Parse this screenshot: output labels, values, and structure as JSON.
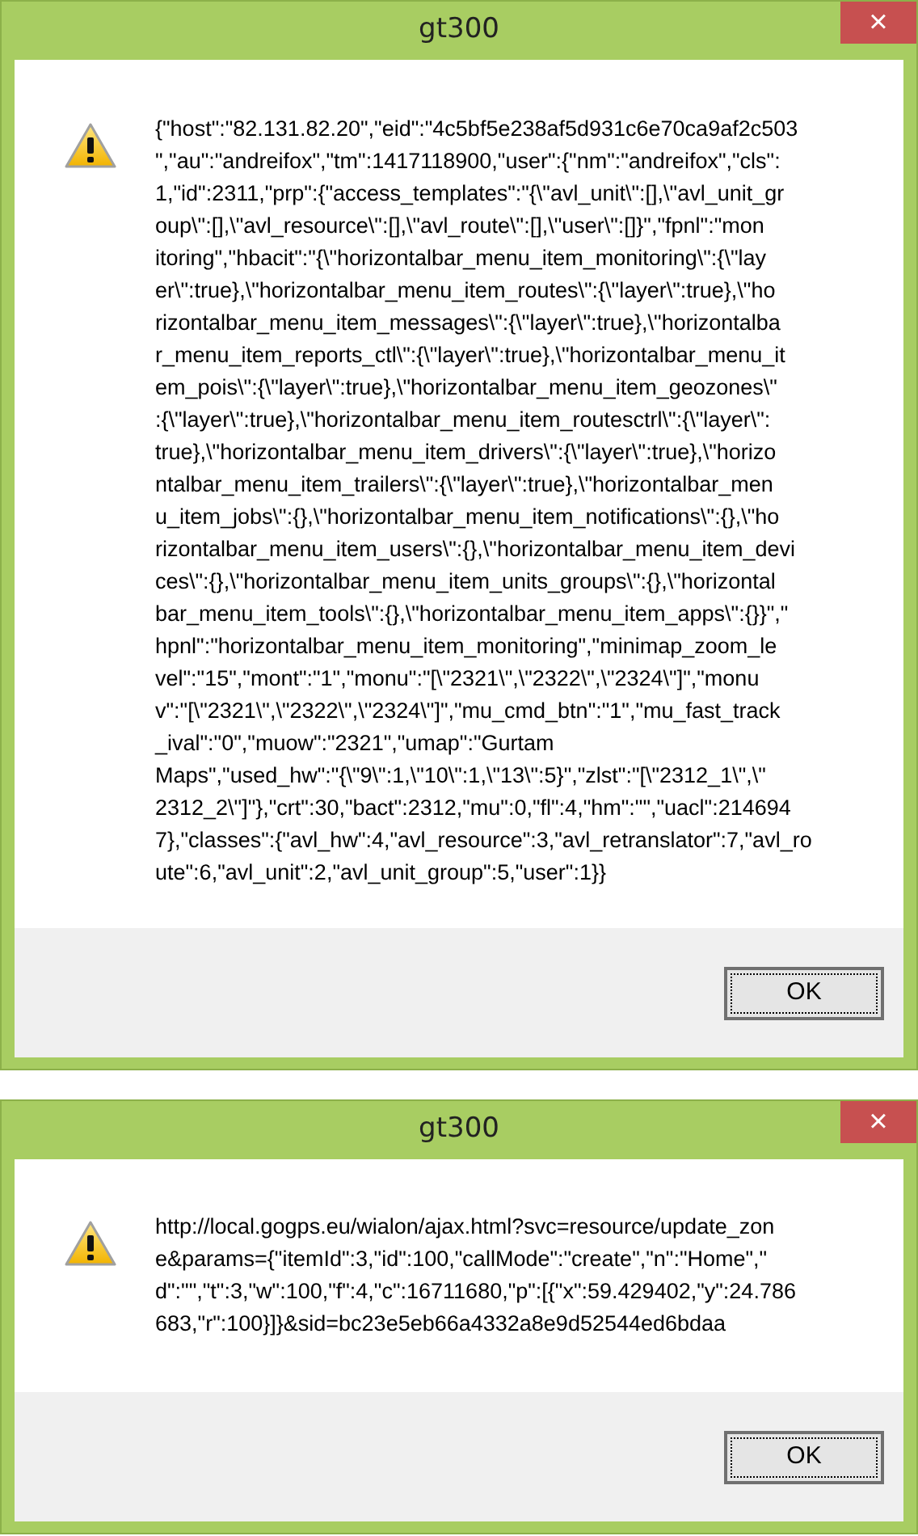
{
  "dialogs": [
    {
      "title": "gt300",
      "close": "×",
      "message_lines": [
        "{\"host\":\"82.131.82.20\",\"eid\":\"4c5bf5e238af5d931c6e70ca9af2c503",
        "\",\"au\":\"andreifox\",\"tm\":1417118900,\"user\":{\"nm\":\"andreifox\",\"cls\":",
        "1,\"id\":2311,\"prp\":{\"access_templates\":\"{\\\"avl_unit\\\":[],\\\"avl_unit_gr",
        "oup\\\":[],\\\"avl_resource\\\":[],\\\"avl_route\\\":[],\\\"user\\\":[]}\",\"fpnl\":\"mon",
        "itoring\",\"hbacit\":\"{\\\"horizontalbar_menu_item_monitoring\\\":{\\\"lay",
        "er\\\":true},\\\"horizontalbar_menu_item_routes\\\":{\\\"layer\\\":true},\\\"ho",
        "rizontalbar_menu_item_messages\\\":{\\\"layer\\\":true},\\\"horizontalba",
        "r_menu_item_reports_ctl\\\":{\\\"layer\\\":true},\\\"horizontalbar_menu_it",
        "em_pois\\\":{\\\"layer\\\":true},\\\"horizontalbar_menu_item_geozones\\\"",
        ":{\\\"layer\\\":true},\\\"horizontalbar_menu_item_routesctrl\\\":{\\\"layer\\\":",
        "true},\\\"horizontalbar_menu_item_drivers\\\":{\\\"layer\\\":true},\\\"horizo",
        "ntalbar_menu_item_trailers\\\":{\\\"layer\\\":true},\\\"horizontalbar_men",
        "u_item_jobs\\\":{},\\\"horizontalbar_menu_item_notifications\\\":{},\\\"ho",
        "rizontalbar_menu_item_users\\\":{},\\\"horizontalbar_menu_item_devi",
        "ces\\\":{},\\\"horizontalbar_menu_item_units_groups\\\":{},\\\"horizontal",
        "bar_menu_item_tools\\\":{},\\\"horizontalbar_menu_item_apps\\\":{}}\",\"",
        "hpnl\":\"horizontalbar_menu_item_monitoring\",\"minimap_zoom_le",
        "vel\":\"15\",\"mont\":\"1\",\"monu\":\"[\\\"2321\\\",\\\"2322\\\",\\\"2324\\\"]\",\"monu",
        "v\":\"[\\\"2321\\\",\\\"2322\\\",\\\"2324\\\"]\",\"mu_cmd_btn\":\"1\",\"mu_fast_track",
        "_ival\":\"0\",\"muow\":\"2321\",\"umap\":\"Gurtam",
        "Maps\",\"used_hw\":\"{\\\"9\\\":1,\\\"10\\\":1,\\\"13\\\":5}\",\"zlst\":\"[\\\"2312_1\\\",\\\"",
        "2312_2\\\"]\"},\"crt\":30,\"bact\":2312,\"mu\":0,\"fl\":4,\"hm\":\"\",\"uacl\":214694",
        "7},\"classes\":{\"avl_hw\":4,\"avl_resource\":3,\"avl_retranslator\":7,\"avl_ro",
        "ute\":6,\"avl_unit\":2,\"avl_unit_group\":5,\"user\":1}}"
      ],
      "button": "OK"
    },
    {
      "title": "gt300",
      "close": "×",
      "message_lines": [
        "http://local.gogps.eu/wialon/ajax.html?svc=resource/update_zon",
        "e&params={\"itemId\":3,\"id\":100,\"callMode\":\"create\",\"n\":\"Home\",\"",
        "d\":\"\",\"t\":3,\"w\":100,\"f\":4,\"c\":16711680,\"p\":[{\"x\":59.429402,\"y\":24.786",
        "683,\"r\":100}]}&sid=bc23e5eb66a4332a8e9d52544ed6bdaa"
      ],
      "button": "OK"
    }
  ]
}
